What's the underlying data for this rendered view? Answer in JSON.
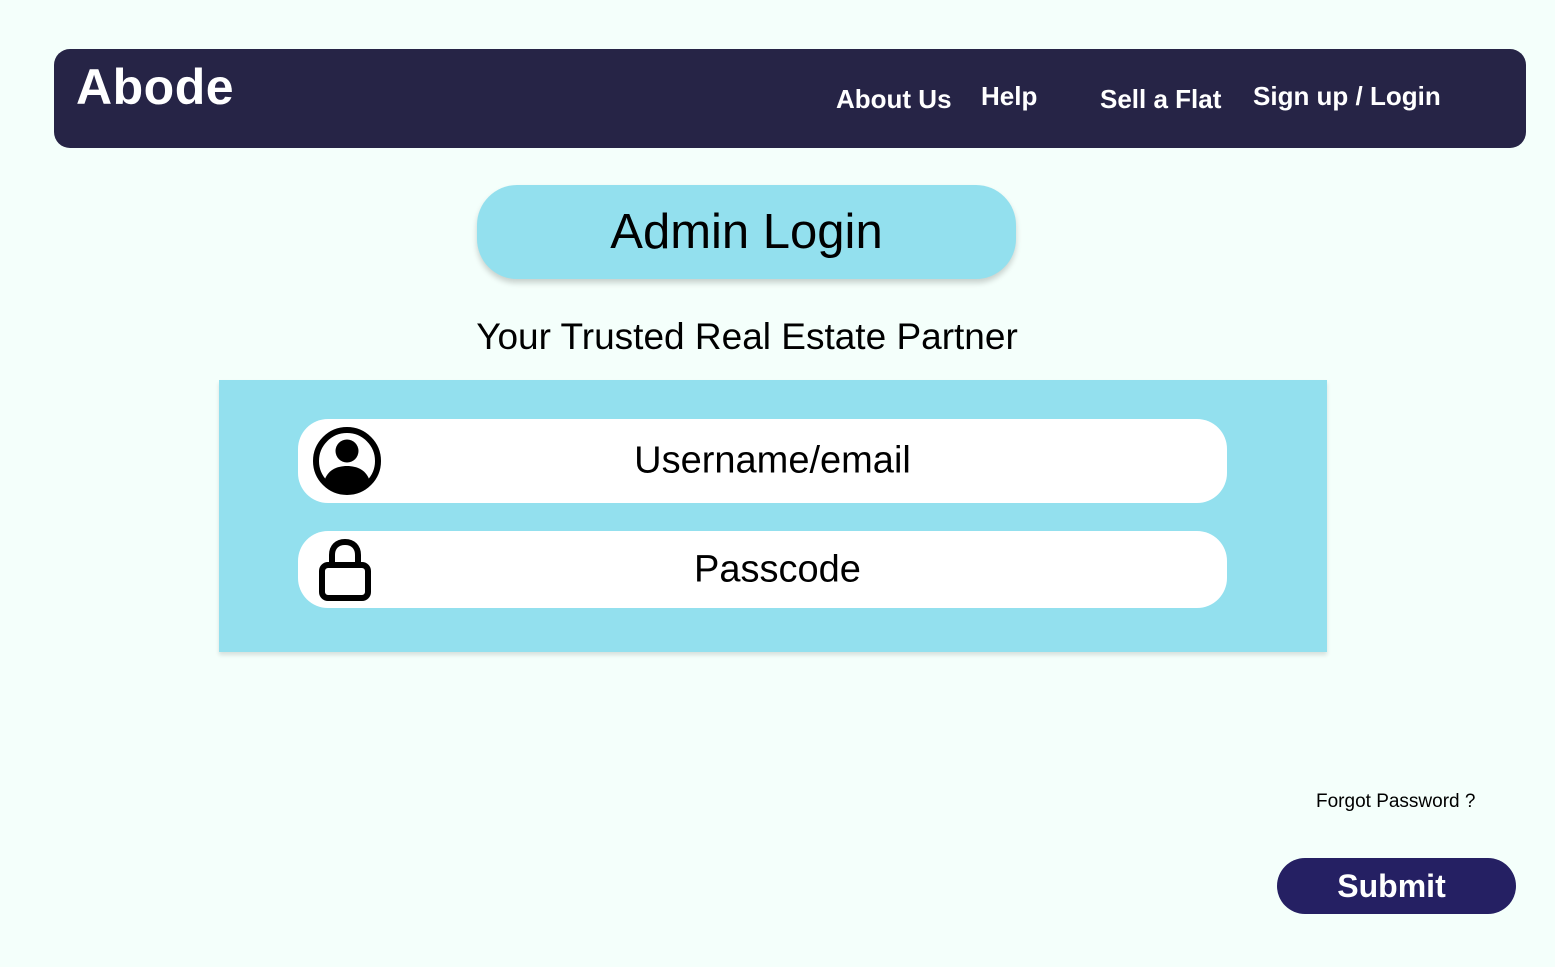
{
  "navbar": {
    "brand": "Abode",
    "links": {
      "about": "About Us",
      "help": "Help",
      "sell": "Sell a Flat",
      "signup": "Sign up / Login"
    }
  },
  "page": {
    "title": "Admin Login",
    "tagline": "Your Trusted Real Estate Partner"
  },
  "form": {
    "username": {
      "placeholder": "Username/email",
      "icon": "user-circle-icon"
    },
    "passcode": {
      "placeholder": "Passcode",
      "icon": "lock-icon"
    },
    "forgot_label": "Forgot Password ?",
    "submit_label": "Submit"
  },
  "colors": {
    "background": "#f4fffb",
    "navbar": "#262446",
    "accent_light": "#93e0ee",
    "submit": "#252063"
  }
}
